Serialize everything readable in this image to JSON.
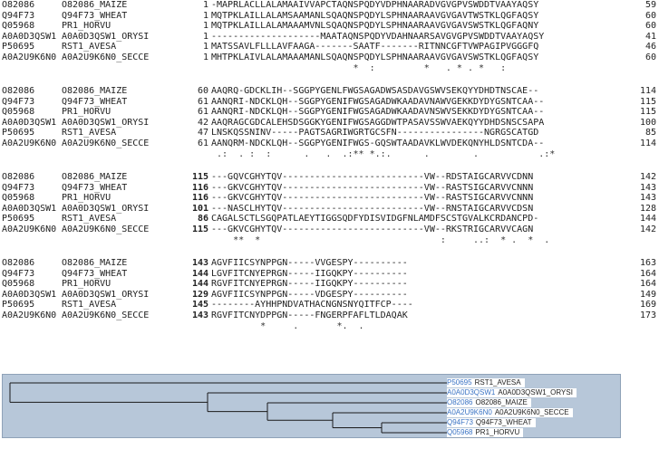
{
  "alignment": {
    "blocks": [
      {
        "start_bold": false,
        "rows": [
          {
            "acc": "O82086",
            "name": "O82086_MAIZE",
            "start": "1",
            "seq": "-MAPRLACLLALAMAAIVVAPCTAQNSPQDYVDPHNAARADVGVGPVSWDDTVAAYAQSY",
            "end": "59"
          },
          {
            "acc": "Q94F73",
            "name": "Q94F73_WHEAT",
            "start": "1",
            "seq": "MQTPKLAILLALAMSAAMANLSQAQNSPQDYLSPHNAARAAVGVGAVTWSTKLQGFAQSY",
            "end": "60"
          },
          {
            "acc": "Q05968",
            "name": "PR1_HORVU",
            "start": "1",
            "seq": "MQTPKLAILLALAMAAAMVNLSQAQNSPQDYLSPHNAARAAVGVGAVSWSTKLQGFAQNY",
            "end": "60"
          },
          {
            "acc": "A0A0D3QSW1",
            "name": "A0A0D3QSW1_ORYSI",
            "start": "1",
            "seq": "--------------------MAATAQNSPQDYVDAHNAARSAVGVGPVSWDDTVAAYAQSY",
            "end": "41"
          },
          {
            "acc": "P50695",
            "name": "RST1_AVESA",
            "start": "1",
            "seq": "MATSSAVLFLLLAVFAAGA-------SAATF-------RITNNCGFTVWPAGIPVGGGFQ",
            "end": "46"
          },
          {
            "acc": "A0A2U9K6N0",
            "name": "A0A2U9K6N0_SECCE",
            "start": "1",
            "seq": "MHTPKLAIVLALAMAAAMANLSQAQNSPQDYLSPHNAARAAVGVGAVSWSTKLQGFAQSY",
            "end": "60"
          }
        ],
        "consensus": "                          *  :         *   . * . *   :          "
      },
      {
        "start_bold": false,
        "rows": [
          {
            "acc": "O82086",
            "name": "O82086_MAIZE",
            "start": "60",
            "seq": "AAQRQ-GDCKLIH--SGGPYGENLFWGSAGADWSASDAVGSWVSEKQYYDHDTNSCAE--",
            "end": "114"
          },
          {
            "acc": "Q94F73",
            "name": "Q94F73_WHEAT",
            "start": "61",
            "seq": "AANQRI-NDCKLQH--SGGPYGENIFWGSAGADWKAADAVNAWVGEKKDYDYGSNTCAA--",
            "end": "115"
          },
          {
            "acc": "Q05968",
            "name": "PR1_HORVU",
            "start": "61",
            "seq": "AANQRI-NDCKLQH--SGGPYGENIFWGSAGADWKAADAVNSWVSEKKDYDYGSNTCAA--",
            "end": "115"
          },
          {
            "acc": "A0A0D3QSW1",
            "name": "A0A0D3QSW1_ORYSI",
            "start": "42",
            "seq": "AAQRAGCGDCALEHSDSGGKYGENIFWGSAGGDWTPASAVSSWVAEKQYYDHDSNSCSAPA",
            "end": "100"
          },
          {
            "acc": "P50695",
            "name": "RST1_AVESA",
            "start": "47",
            "seq": "LNSKQSSNINV-----PAGTSAGRIWGRTGCSFN----------------NGRGSCATGD",
            "end": "85"
          },
          {
            "acc": "A0A2U9K6N0",
            "name": "A0A2U9K6N0_SECCE",
            "start": "61",
            "seq": "AANQRM-NDCKLQH--SGGPYGENIFWGS-GQSWTAADAVKLWVDEKQNYHLDSNTCDA--",
            "end": "114"
          }
        ],
        "consensus": " .:  . :  :      .   .  .:** *.:.      .        .           .:*"
      },
      {
        "start_bold": true,
        "rows": [
          {
            "acc": "O82086",
            "name": "O82086_MAIZE",
            "start": "115",
            "seq": "---GQVCGHYTQV--------------------------VW--RDSTAIGCARVVCDNN",
            "end": "142"
          },
          {
            "acc": "Q94F73",
            "name": "Q94F73_WHEAT",
            "start": "116",
            "seq": "---GKVCGHYTQV--------------------------VW--RASTSIGCARVVCNNN",
            "end": "143"
          },
          {
            "acc": "Q05968",
            "name": "PR1_HORVU",
            "start": "116",
            "seq": "---GKVCGHYTQV--------------------------VW--RASTSIGCARVVCNNN",
            "end": "143"
          },
          {
            "acc": "A0A0D3QSW1",
            "name": "A0A0D3QSW1_ORYSI",
            "start": "101",
            "seq": "---NASCLHYTQV--------------------------VW--RNSTAIGCARVVCDSN",
            "end": "128"
          },
          {
            "acc": "P50695",
            "name": "RST1_AVESA",
            "start": "86",
            "seq": "CAGALSCTLSGQPATLAEYTIGGSQDFYDISVIDGFNLAMDFSCSTGVALKCRDANCPD-",
            "end": "144"
          },
          {
            "acc": "A0A2U9K6N0",
            "name": "A0A2U9K6N0_SECCE",
            "start": "115",
            "seq": "---GKVCGHYTQV--------------------------VW--RKSTRIGCARVVCAGN",
            "end": "142"
          }
        ],
        "consensus": "    **  *                                 :     ..:  * .  *  ."
      },
      {
        "start_bold": true,
        "rows": [
          {
            "acc": "O82086",
            "name": "O82086_MAIZE",
            "start": "143",
            "seq": "AGVFIICSYNPPGN-----VVGESPY----------",
            "end": "163"
          },
          {
            "acc": "Q94F73",
            "name": "Q94F73_WHEAT",
            "start": "144",
            "seq": "LGVFITCNYEPRGN-----IIGQKPY----------",
            "end": "164"
          },
          {
            "acc": "Q05968",
            "name": "PR1_HORVU",
            "start": "144",
            "seq": "RGVFITCNYEPRGN-----IIGQKPY----------",
            "end": "164"
          },
          {
            "acc": "A0A0D3QSW1",
            "name": "A0A0D3QSW1_ORYSI",
            "start": "129",
            "seq": "AGVFIICSYNPPGN-----VDGESPY----------",
            "end": "149"
          },
          {
            "acc": "P50695",
            "name": "RST1_AVESA",
            "start": "145",
            "seq": "--------AYHHPNDVATHACNGNSNYQITFCP----",
            "end": "169"
          },
          {
            "acc": "A0A2U9K6N0",
            "name": "A0A2U9K6N0_SECCE",
            "start": "143",
            "seq": "RGVFITCNYDPPGN-----FNGERPFAFLTLDAQAK",
            "end": "173"
          }
        ],
        "consensus": "         *     .       *.  ."
      }
    ]
  },
  "tree": {
    "leaves": [
      {
        "id": "P50695",
        "label": "RST1_AVESA"
      },
      {
        "id": "A0A0D3QSW1",
        "label": "A0A0D3QSW1_ORYSI"
      },
      {
        "id": "O82086",
        "label": "O82086_MAIZE"
      },
      {
        "id": "A0A2U9K6N0",
        "label": "A0A2U9K6N0_SECCE"
      },
      {
        "id": "Q94F73",
        "label": "Q94F73_WHEAT"
      },
      {
        "id": "Q05968",
        "label": "PR1_HORVU"
      }
    ],
    "colors": {
      "panel_bg": "#b7c7d9",
      "link": "#3a73c4",
      "branch": "#1a1a1a"
    }
  }
}
